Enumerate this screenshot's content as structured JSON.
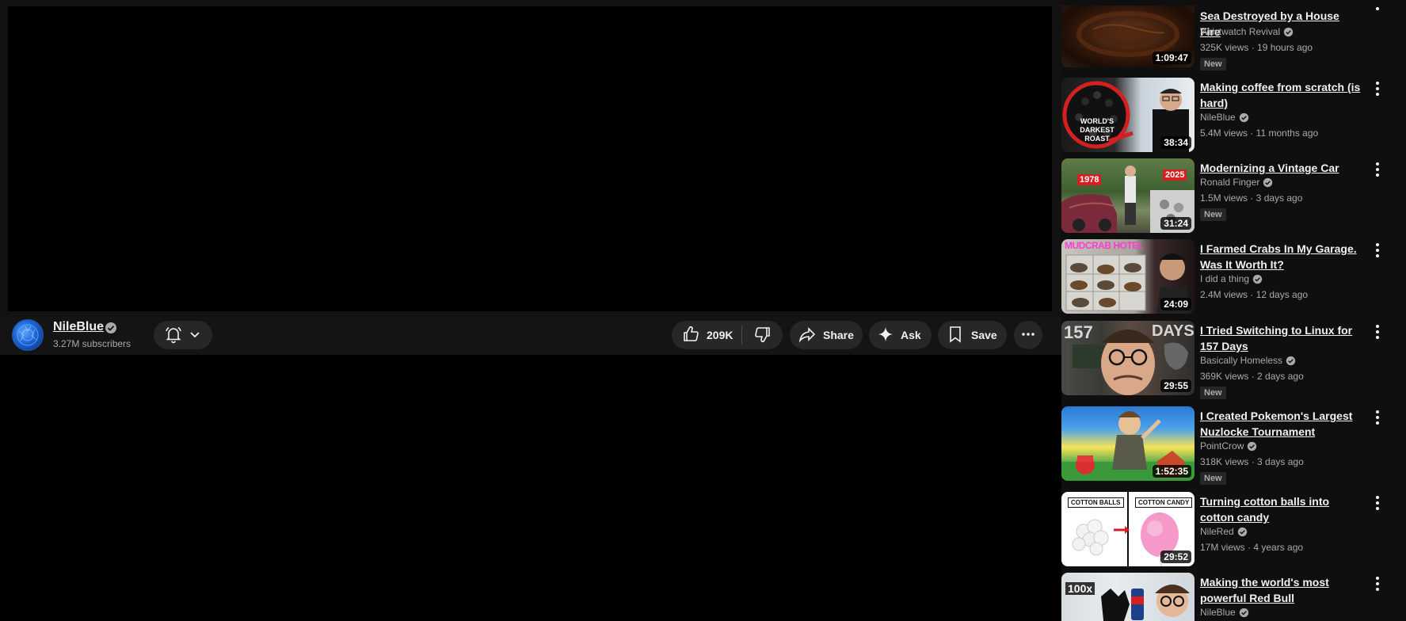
{
  "channel": {
    "name": "NileBlue",
    "subscribers": "3.27M subscribers"
  },
  "actions": {
    "likes": "209K",
    "share_label": "Share",
    "ask_label": "Ask",
    "save_label": "Save"
  },
  "recommendations": [
    {
      "title": "Sea Destroyed by a House Fire",
      "channel": "Wristwatch Revival",
      "meta": "325K views · 19 hours ago",
      "duration": "1:09:47",
      "badge": "New"
    },
    {
      "title": "Making coffee from scratch (is hard)",
      "channel": "NileBlue",
      "meta": "5.4M views · 11 months ago",
      "duration": "38:34",
      "thumb_text": "WORLD'S DARKEST ROAST"
    },
    {
      "title": "Modernizing a Vintage Car",
      "channel": "Ronald Finger",
      "meta": "1.5M views · 3 days ago",
      "duration": "31:24",
      "badge": "New",
      "thumb_left": "1978",
      "thumb_right": "2025"
    },
    {
      "title": "I Farmed Crabs In My Garage. Was It Worth It?",
      "channel": "I did a thing",
      "meta": "2.4M views · 12 days ago",
      "duration": "24:09",
      "thumb_text": "MUDCRAB HOTEL"
    },
    {
      "title": "I Tried Switching to Linux for 157 Days",
      "channel": "Basically Homeless",
      "meta": "369K views · 2 days ago",
      "duration": "29:55",
      "badge": "New",
      "thumb_left": "157",
      "thumb_right": "DAYS"
    },
    {
      "title": "I Created Pokemon's Largest Nuzlocke Tournament",
      "channel": "PointCrow",
      "meta": "318K views · 3 days ago",
      "duration": "1:52:35",
      "badge": "New"
    },
    {
      "title": "Turning cotton balls into cotton candy",
      "channel": "NileRed",
      "meta": "17M views · 4 years ago",
      "duration": "29:52",
      "thumb_left": "COTTON BALLS",
      "thumb_right": "COTTON CANDY"
    },
    {
      "title": "Making the world's most powerful Red Bull",
      "channel": "NileBlue",
      "thumb_text": "100x"
    }
  ]
}
